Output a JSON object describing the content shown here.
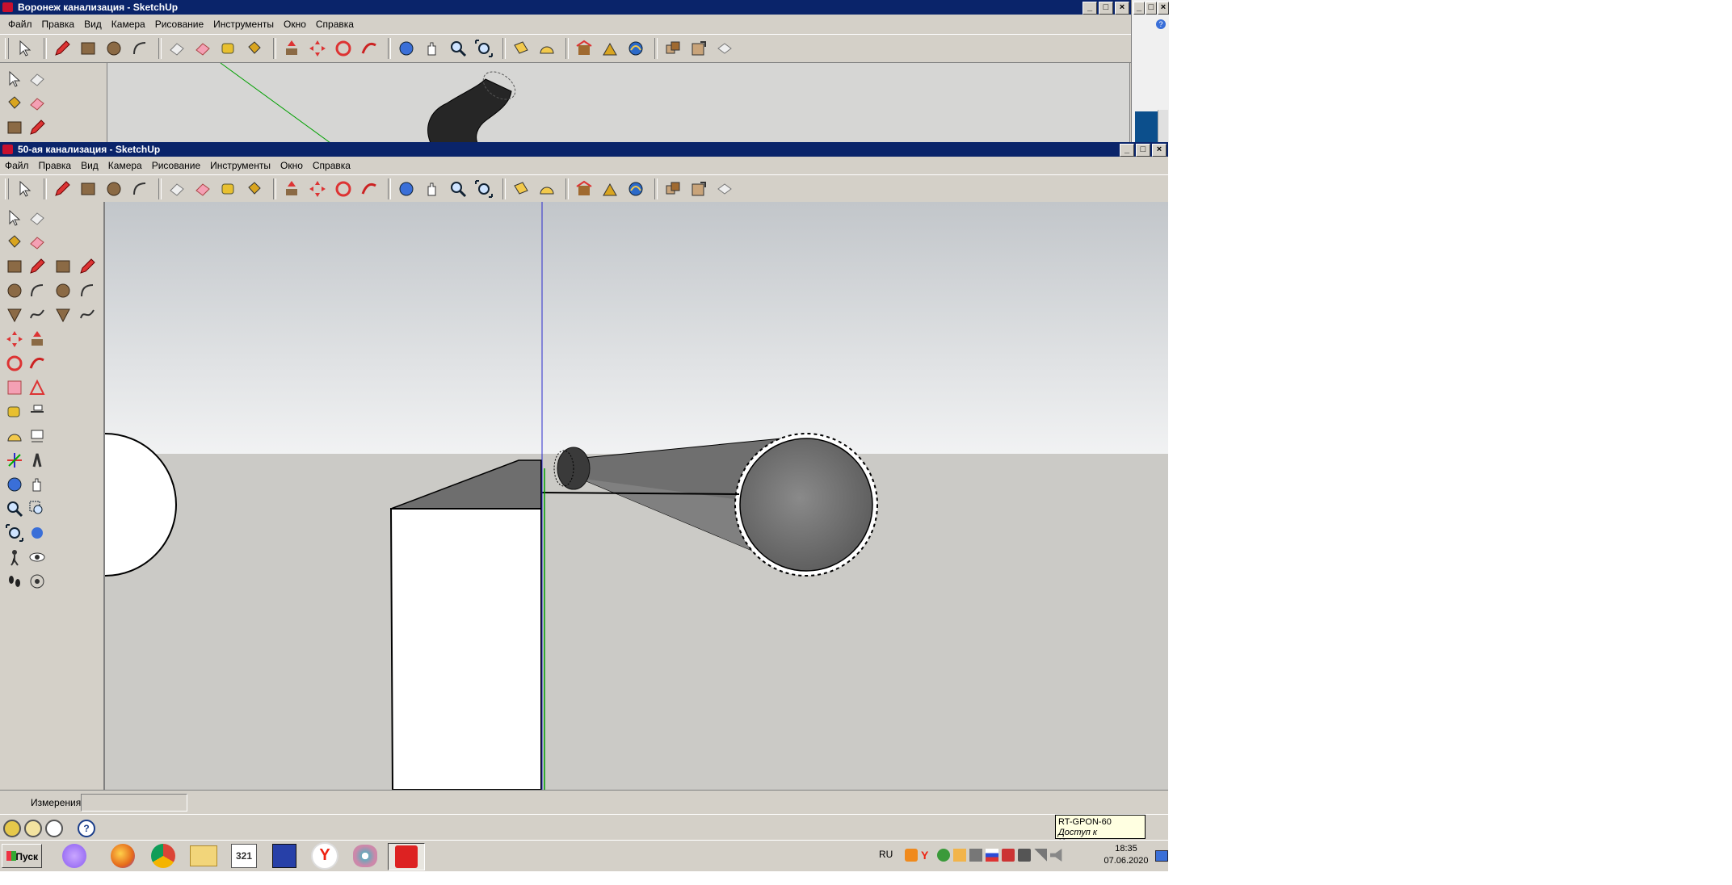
{
  "back_window": {
    "title": "Воронеж канализация - SketchUp",
    "menu": [
      "Файл",
      "Правка",
      "Вид",
      "Камера",
      "Рисование",
      "Инструменты",
      "Окно",
      "Справка"
    ],
    "controls": {
      "minimize": "_",
      "maximize": "□",
      "close": "×"
    }
  },
  "front_window": {
    "title": "50-ая канализация - SketchUp",
    "menu": [
      "Файл",
      "Правка",
      "Вид",
      "Камера",
      "Рисование",
      "Инструменты",
      "Окно",
      "Справка"
    ],
    "controls": {
      "minimize": "_",
      "maximize": "□",
      "close": "×"
    }
  },
  "toolbar_icons": [
    "select-icon",
    "pencil-icon",
    "rectangle-icon",
    "circle-icon",
    "arc-icon",
    "eraser-icon",
    "paint-eraser-icon",
    "tape-measure-icon",
    "paint-bucket-icon",
    "push-pull-icon",
    "move-icon",
    "rotate-icon",
    "follow-me-icon",
    "orbit-icon",
    "pan-icon",
    "zoom-icon",
    "zoom-extents-icon",
    "section-plane-icon",
    "protractor-icon",
    "warehouse-icon",
    "google-earth-icon",
    "geo-location-icon",
    "components-icon",
    "share-model-icon",
    "layout-icon"
  ],
  "sidebar_icons": [
    "select-icon",
    "eraser-icon",
    "paint-bucket-icon",
    "eraser-pink-icon",
    "rectangle-icon",
    "pencil-icon",
    "circle-icon",
    "arc-icon",
    "polygon-icon",
    "freehand-icon",
    "move-icon",
    "push-pull-icon",
    "rotate-icon",
    "follow-me-icon",
    "scale-icon",
    "offset-icon",
    "tape-measure-icon",
    "dimension-icon",
    "protractor-icon",
    "text-icon",
    "axes-icon",
    "3d-text-icon",
    "orbit-icon",
    "pan-icon",
    "zoom-icon",
    "zoom-window-icon",
    "zoom-extents-icon",
    "previous-view-icon",
    "walk-icon",
    "look-around-icon",
    "footprints-icon",
    "position-camera-icon"
  ],
  "status": {
    "measure_label": "Измерения",
    "measure_value": ""
  },
  "tooltip": {
    "network": "RT-GPON-60",
    "status": "Доступ к Интернету"
  },
  "taskbar": {
    "start_label": "Пуск",
    "language": "RU",
    "time": "18:35",
    "date": "07.06.2020"
  },
  "colors": {
    "title_active": "#0a246a",
    "face_color": "#d4d0c8",
    "sky_top": "#c4c8cc",
    "sky_bottom": "#eef0f1",
    "ground": "#cbcac6",
    "blue_axis": "#1f1fcc",
    "green_axis": "#00a000"
  }
}
